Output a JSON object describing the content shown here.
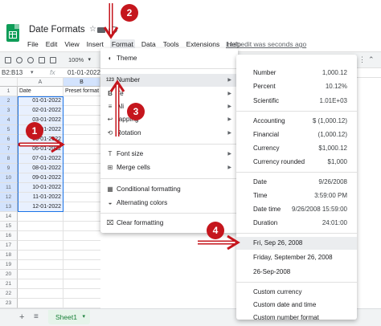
{
  "header": {
    "title": "Date Formats",
    "menus": [
      "File",
      "Edit",
      "View",
      "Insert",
      "Format",
      "Data",
      "Tools",
      "Extensions",
      "Help"
    ],
    "last_edit": "Last edit was seconds ago"
  },
  "toolbar": {
    "zoom": "100%",
    "name_box": "B2:B13",
    "fx": "fx",
    "formula_value": "01-01-2022"
  },
  "grid": {
    "col_headers": [
      "A",
      "B"
    ],
    "rows": [
      {
        "num": "1",
        "a": "Date",
        "b": "Preset format"
      },
      {
        "num": "2",
        "a": "01-01-2022",
        "b": ""
      },
      {
        "num": "3",
        "a": "02-01-2022",
        "b": ""
      },
      {
        "num": "4",
        "a": "03-01-2022",
        "b": ""
      },
      {
        "num": "5",
        "a": "04-01-2022",
        "b": ""
      },
      {
        "num": "6",
        "a": "05-01-2022",
        "b": ""
      },
      {
        "num": "7",
        "a": "06-01-2022",
        "b": ""
      },
      {
        "num": "8",
        "a": "07-01-2022",
        "b": ""
      },
      {
        "num": "9",
        "a": "08-01-2022",
        "b": ""
      },
      {
        "num": "10",
        "a": "09-01-2022",
        "b": ""
      },
      {
        "num": "11",
        "a": "10-01-2022",
        "b": ""
      },
      {
        "num": "12",
        "a": "11-01-2022",
        "b": ""
      },
      {
        "num": "13",
        "a": "12-01-2022",
        "b": ""
      },
      {
        "num": "14",
        "a": "",
        "b": ""
      },
      {
        "num": "15",
        "a": "",
        "b": ""
      },
      {
        "num": "16",
        "a": "",
        "b": ""
      },
      {
        "num": "17",
        "a": "",
        "b": ""
      },
      {
        "num": "18",
        "a": "",
        "b": ""
      },
      {
        "num": "19",
        "a": "",
        "b": ""
      },
      {
        "num": "20",
        "a": "",
        "b": ""
      },
      {
        "num": "21",
        "a": "",
        "b": ""
      },
      {
        "num": "22",
        "a": "",
        "b": ""
      },
      {
        "num": "23",
        "a": "",
        "b": ""
      }
    ]
  },
  "format_menu": {
    "items": [
      {
        "icon": "palette-icon",
        "label": "Theme"
      },
      {
        "icon": "number-123-icon",
        "label": "Number"
      },
      {
        "icon": "bold-icon",
        "label": "Text"
      },
      {
        "icon": "align-icon",
        "label": "Alignment"
      },
      {
        "icon": "wrap-icon",
        "label": "Wrapping"
      },
      {
        "icon": "rotate-icon",
        "label": "Rotation"
      },
      {
        "icon": "font-size-icon",
        "label": "Font size"
      },
      {
        "icon": "merge-icon",
        "label": "Merge cells"
      },
      {
        "icon": "conditional-format-icon",
        "label": "Conditional formatting"
      },
      {
        "icon": "alternating-colors-icon",
        "label": "Alternating colors"
      },
      {
        "icon": "clear-format-icon",
        "label": "Clear formatting"
      }
    ],
    "visible_labels": {
      "alignment": "Ali",
      "wrapping": "rapping",
      "text": "Te"
    }
  },
  "number_menu": {
    "items": [
      {
        "label": "Number",
        "sample": "1,000.12"
      },
      {
        "label": "Percent",
        "sample": "10.12%"
      },
      {
        "label": "Scientific",
        "sample": "1.01E+03"
      },
      {
        "label": "Accounting",
        "sample": "$ (1,000.12)"
      },
      {
        "label": "Financial",
        "sample": "(1,000.12)"
      },
      {
        "label": "Currency",
        "sample": "$1,000.12"
      },
      {
        "label": "Currency rounded",
        "sample": "$1,000"
      },
      {
        "label": "Date",
        "sample": "9/26/2008"
      },
      {
        "label": "Time",
        "sample": "3:59:00 PM"
      },
      {
        "label": "Date time",
        "sample": "9/26/2008 15:59:00"
      },
      {
        "label": "Duration",
        "sample": "24:01:00"
      },
      {
        "label": "Fri, Sep 26, 2008",
        "sample": ""
      },
      {
        "label": "Friday, September 26, 2008",
        "sample": ""
      },
      {
        "label": "26-Sep-2008",
        "sample": ""
      },
      {
        "label": "Custom currency",
        "sample": ""
      },
      {
        "label": "Custom date and time",
        "sample": ""
      },
      {
        "label": "Custom number format",
        "sample": ""
      }
    ]
  },
  "sheets": {
    "tab": "Sheet1",
    "add": "+",
    "all": "≡"
  },
  "annotations": [
    "1",
    "2",
    "3",
    "4"
  ],
  "colors": {
    "accent": "#1a73e8",
    "annotation": "#c5161d",
    "sheet_green": "#188038"
  }
}
